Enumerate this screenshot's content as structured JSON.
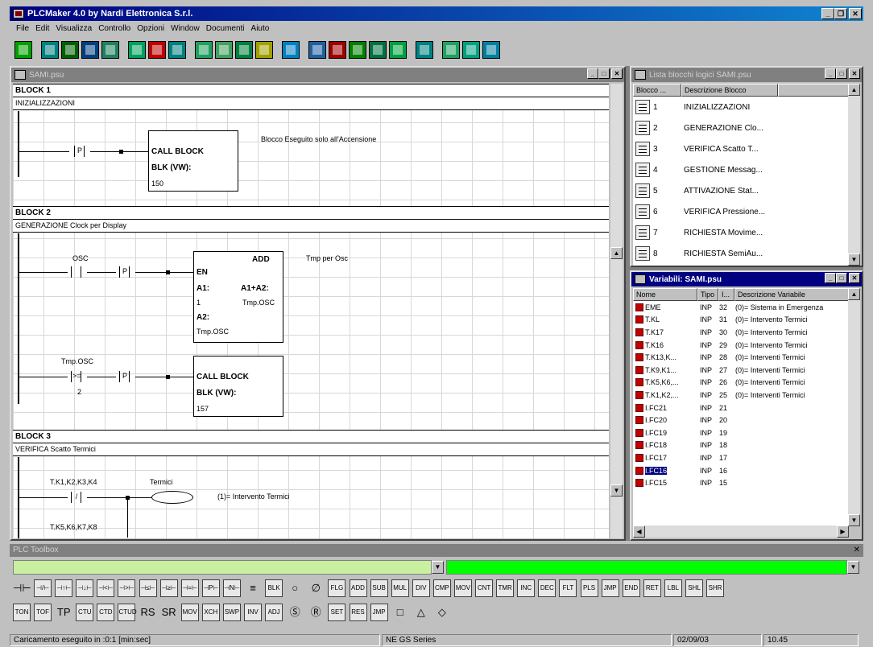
{
  "app": {
    "title": "PLCMaker 4.0 by Nardi Elettronica S.r.l.",
    "menu": [
      "File",
      "Edit",
      "Visualizza",
      "Controllo",
      "Opzioni",
      "Window",
      "Documenti",
      "Aiuto"
    ]
  },
  "toolbar": {
    "buttons": [
      {
        "name": "new-icon",
        "color": "#00a000"
      },
      {
        "name": "open-icon",
        "color": "#008080"
      },
      {
        "name": "save-icon",
        "color": "#006000"
      },
      {
        "name": "save-as-icon",
        "color": "#004080"
      },
      {
        "name": "grid-icon",
        "color": "#208060"
      },
      {
        "name": "copy-icon",
        "color": "#00a060"
      },
      {
        "name": "cut-icon",
        "color": "#c00000"
      },
      {
        "name": "paste-icon",
        "color": "#008080"
      },
      {
        "name": "list-icon",
        "color": "#20a060"
      },
      {
        "name": "table-icon",
        "color": "#40a060"
      },
      {
        "name": "block-icon",
        "color": "#008040"
      },
      {
        "name": "compile-icon",
        "color": "#a0a000"
      },
      {
        "name": "monitor-icon",
        "color": "#0080c0"
      },
      {
        "name": "connect-icon",
        "color": "#2060a0"
      },
      {
        "name": "stop-icon",
        "color": "#a00000"
      },
      {
        "name": "download-icon",
        "color": "#008000"
      },
      {
        "name": "upload-icon",
        "color": "#007040"
      },
      {
        "name": "run-icon",
        "color": "#00a040"
      },
      {
        "name": "print-icon",
        "color": "#008080"
      },
      {
        "name": "window-icon",
        "color": "#20a060"
      },
      {
        "name": "split-icon",
        "color": "#00a080"
      },
      {
        "name": "help-icon",
        "color": "#0080a0"
      }
    ]
  },
  "editor": {
    "title": "SAMI.psu",
    "blocks": [
      {
        "title": "BLOCK 1",
        "desc": "INIZIALIZZAZIONI",
        "contact_sym": "P",
        "box_title": "CALL BLOCK",
        "box_line": "BLK (VW):",
        "box_value": "150",
        "comment": "Blocco Eseguito solo all'Accensione"
      },
      {
        "title": "BLOCK 2",
        "desc": "GENERAZIONE Clock per Display",
        "osc_label": "OSC",
        "add_title": "ADD",
        "add_en": "EN",
        "add_a1": "A1:",
        "add_a1a2": "A1+A2:",
        "add_one": "1",
        "add_tmp_osc": "Tmp.OSC",
        "add_a2": "A2:",
        "add_tmp_osc2": "Tmp.OSC",
        "add_comment": "Tmp per Osc",
        "cmp_label": "Tmp.OSC",
        "cmp_sym": ">=",
        "cmp_value": "2",
        "box_title": "CALL BLOCK",
        "box_line": "BLK (VW):",
        "box_value": "157",
        "contact_sym": "P"
      },
      {
        "title": "BLOCK 3",
        "desc": "VERIFICA Scatto Termici",
        "contact1_label": "T.K1,K2,K3,K4",
        "coil_label": "Termici",
        "coil_comment": "(1)= Intervento Termici",
        "contact2_label": "T.K5,K6,K7,K8"
      }
    ]
  },
  "lista": {
    "title": "Lista blocchi logici SAMI.psu",
    "columns": [
      "Blocco ...",
      "Descrizione Blocco"
    ],
    "rows": [
      {
        "num": "1",
        "desc": "INIZIALIZZAZIONI"
      },
      {
        "num": "2",
        "desc": "GENERAZIONE Clo..."
      },
      {
        "num": "3",
        "desc": "VERIFICA Scatto T..."
      },
      {
        "num": "4",
        "desc": "GESTIONE Messag..."
      },
      {
        "num": "5",
        "desc": "ATTIVAZIONE Stat..."
      },
      {
        "num": "6",
        "desc": "VERIFICA Pressione..."
      },
      {
        "num": "7",
        "desc": "RICHIESTA Movime..."
      },
      {
        "num": "8",
        "desc": "RICHIESTA SemiAu..."
      }
    ]
  },
  "variabili": {
    "title": "Variabili: SAMI.psu",
    "columns": [
      "Nome",
      "Tipo",
      "I...",
      "Descrizione Variabile"
    ],
    "rows": [
      {
        "name": "EME",
        "tipo": "INP",
        "idx": "32",
        "desc": "(0)= Sistema in Emergenza"
      },
      {
        "name": "T.KL",
        "tipo": "INP",
        "idx": "31",
        "desc": "(0)= Intervento Termici"
      },
      {
        "name": "T.K17",
        "tipo": "INP",
        "idx": "30",
        "desc": "(0)= Intervento Termici"
      },
      {
        "name": "T.K16",
        "tipo": "INP",
        "idx": "29",
        "desc": "(0)= Intervento Termici"
      },
      {
        "name": "T.K13,K...",
        "tipo": "INP",
        "idx": "28",
        "desc": "(0)= Interventi Termici"
      },
      {
        "name": "T.K9,K1...",
        "tipo": "INP",
        "idx": "27",
        "desc": "(0)= Interventi Termici"
      },
      {
        "name": "T.K5,K6,...",
        "tipo": "INP",
        "idx": "26",
        "desc": "(0)= Interventi Termici"
      },
      {
        "name": "T.K1,K2,...",
        "tipo": "INP",
        "idx": "25",
        "desc": "(0)= Interventi Termici"
      },
      {
        "name": "I.FC21",
        "tipo": "INP",
        "idx": "21",
        "desc": ""
      },
      {
        "name": "I.FC20",
        "tipo": "INP",
        "idx": "20",
        "desc": ""
      },
      {
        "name": "I.FC19",
        "tipo": "INP",
        "idx": "19",
        "desc": ""
      },
      {
        "name": "I.FC18",
        "tipo": "INP",
        "idx": "18",
        "desc": ""
      },
      {
        "name": "I.FC17",
        "tipo": "INP",
        "idx": "17",
        "desc": ""
      },
      {
        "name": "I.FC16",
        "tipo": "INP",
        "idx": "16",
        "desc": "",
        "selected": true
      },
      {
        "name": "I.FC15",
        "tipo": "INP",
        "idx": "15",
        "desc": ""
      }
    ]
  },
  "toolbox": {
    "title": "PLC Toolbox",
    "field_left_color": "#c8f0a0",
    "field_right_color": "#00ff00",
    "row1_symbols": [
      "⊣⊢",
      "⊣/⊢",
      "⊣↑⊢",
      "⊣↓⊢",
      "⊣<⊢",
      "⊣>⊢",
      "⊣≤⊢",
      "⊣≥⊢",
      "⊣=⊢",
      "⊣P⊢",
      "⊣N⊢",
      "≡",
      "BLK",
      "○",
      "∅",
      "FLG",
      "ADD",
      "SUB",
      "MUL",
      "DIV",
      "CMP",
      "MOV",
      "CNT",
      "TMR",
      "INC",
      "DEC",
      "FLT",
      "PLS",
      "JMP",
      "END",
      "RET",
      "LBL",
      "SHL",
      "SHR"
    ],
    "row2_symbols": [
      "TON",
      "TOF",
      "TP",
      "CTU",
      "CTD",
      "CTUD",
      "RS",
      "SR",
      "MOV",
      "XCH",
      "SWP",
      "INV",
      "ADJ",
      "Ⓢ",
      "Ⓡ",
      "SET",
      "RES",
      "JMP",
      "□",
      "△",
      "◇"
    ]
  },
  "status": {
    "message": "Caricamento eseguito in :0:1 [min:sec]",
    "series": "NE GS Series",
    "date": "02/09/03",
    "time": "10.45"
  }
}
